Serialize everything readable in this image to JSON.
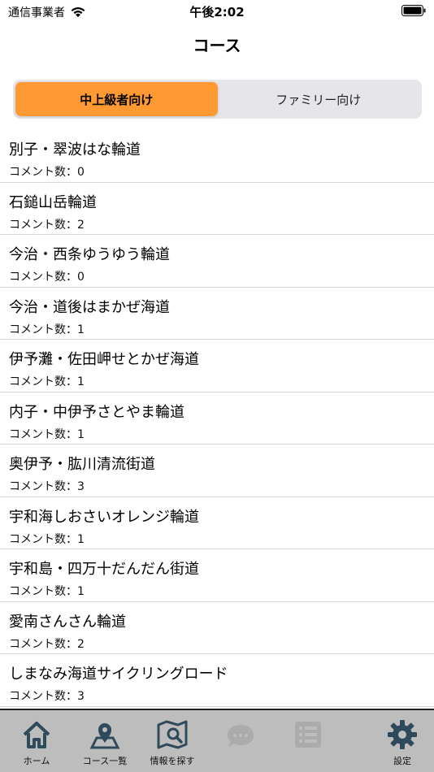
{
  "status_bar": {
    "carrier": "通信事業者",
    "time": "午後2:02"
  },
  "nav": {
    "title": "コース"
  },
  "segments": [
    {
      "label": "中上級者向け",
      "selected": true
    },
    {
      "label": "ファミリー向け",
      "selected": false
    }
  ],
  "accent_color": "#ff9a32",
  "courses": [
    {
      "name": "別子・翠波はな輪道",
      "comments": "コメント数：0"
    },
    {
      "name": "石鎚山岳輪道",
      "comments": "コメント数：2"
    },
    {
      "name": "今治・西条ゆうゆう輪道",
      "comments": "コメント数：0"
    },
    {
      "name": "今治・道後はまかぜ海道",
      "comments": "コメント数：1"
    },
    {
      "name": "伊予灘・佐田岬せとかぜ海道",
      "comments": "コメント数：1"
    },
    {
      "name": "内子・中伊予さとやま輪道",
      "comments": "コメント数：1"
    },
    {
      "name": "奥伊予・肱川清流街道",
      "comments": "コメント数：3"
    },
    {
      "name": "宇和海しおさいオレンジ輪道",
      "comments": "コメント数：1"
    },
    {
      "name": "宇和島・四万十だんだん街道",
      "comments": "コメント数：1"
    },
    {
      "name": "愛南さんさん輪道",
      "comments": "コメント数：2"
    },
    {
      "name": "しまなみ海道サイクリングロード",
      "comments": "コメント数：3"
    }
  ],
  "tab_bar": {
    "home": "ホーム",
    "course_list": "コース一覧",
    "find_info": "情報を探す",
    "settings": "設定",
    "icons": [
      "home-icon",
      "map-pin-icon",
      "map-search-icon",
      "chat-icon",
      "list-icon",
      "gear-icon"
    ]
  }
}
